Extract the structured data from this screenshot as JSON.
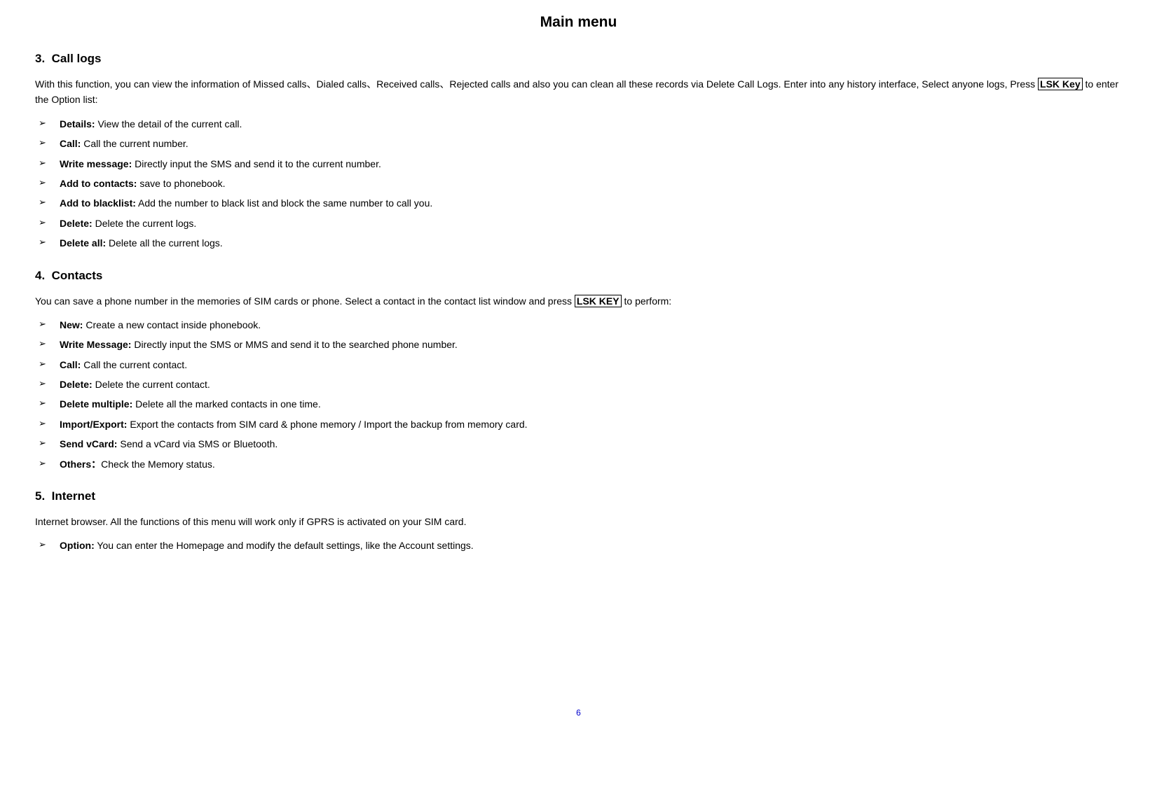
{
  "page_title": "Main menu",
  "sections": {
    "call_logs": {
      "number": "3.",
      "title": "Call logs",
      "intro_part1": "With this function, you can view the information of Missed calls、Dialed calls、Received calls、Rejected calls and also you can clean all these records via Delete Call Logs. Enter into any history interface, Select anyone logs, Press ",
      "lsk_label": "LSK Key",
      "intro_part2": " to enter the Option list:",
      "items": [
        {
          "term": "Details:",
          "desc": " View the detail of the current call."
        },
        {
          "term": "Call:",
          "desc": " Call the current number."
        },
        {
          "term": "Write message:",
          "desc": " Directly input the SMS and send it to the current number."
        },
        {
          "term": "Add to contacts:",
          "desc": " save to phonebook."
        },
        {
          "term": "Add to blacklist:",
          "desc": " Add the number to black list and block the same number to call you."
        },
        {
          "term": "Delete:",
          "desc": " Delete the current logs."
        },
        {
          "term": "Delete all:",
          "desc": " Delete all the current logs."
        }
      ]
    },
    "contacts": {
      "number": "4.",
      "title": "Contacts",
      "intro_part1": "You can save a phone number in the memories of SIM cards or phone. Select a contact in the contact list window and press ",
      "lsk_label": "LSK KEY",
      "intro_part2": " to perform:",
      "items": [
        {
          "term": "New:",
          "desc": " Create a new contact inside phonebook."
        },
        {
          "term": "Write Message:",
          "desc": " Directly input the SMS or MMS and send it to the searched phone number."
        },
        {
          "term": "Call:",
          "desc": " Call the current contact."
        },
        {
          "term": "Delete:",
          "desc": " Delete the current contact."
        },
        {
          "term": "Delete multiple:",
          "desc": " Delete all the marked contacts in one time."
        },
        {
          "term": "Import/Export:",
          "desc": " Export the contacts from SIM card & phone memory / Import the backup from memory card."
        },
        {
          "term": "Send vCard:",
          "desc": " Send a vCard via SMS or Bluetooth."
        },
        {
          "term": "Others：",
          "desc": "Check the Memory status."
        }
      ]
    },
    "internet": {
      "number": "5.",
      "title": "Internet",
      "intro": "Internet browser. All the functions of this menu will work only if GPRS is activated on your SIM card.",
      "items": [
        {
          "term": "Option:",
          "desc": " You can enter the Homepage and modify the default settings, like the Account settings."
        }
      ]
    }
  },
  "page_number": "6"
}
